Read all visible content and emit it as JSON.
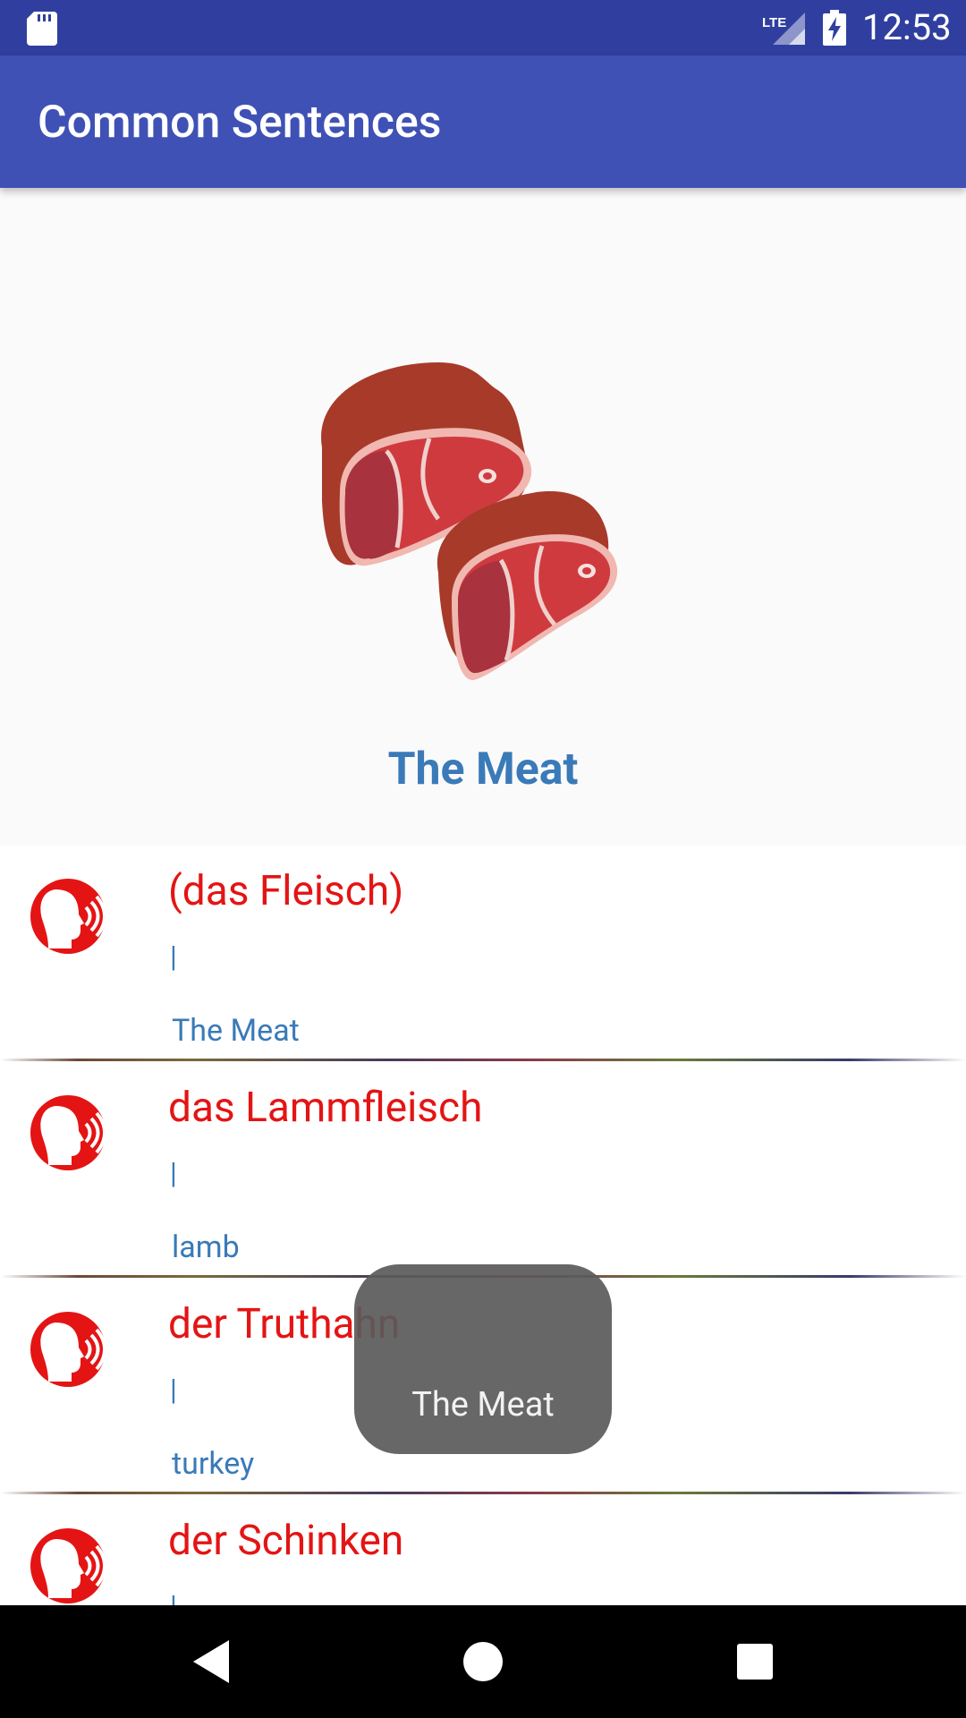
{
  "status_bar": {
    "network": "LTE",
    "time": "12:53"
  },
  "app_bar": {
    "title": "Common Sentences"
  },
  "hero": {
    "image_icon": "meat-steaks-illustration",
    "heading": "The Meat"
  },
  "list": {
    "items": [
      {
        "german": "(das Fleisch)",
        "separator": "|",
        "english": "The Meat",
        "icon": "speaker-head-icon"
      },
      {
        "german": "das Lammfleisch",
        "separator": "|",
        "english": "lamb",
        "icon": "speaker-head-icon"
      },
      {
        "german": "der Truthahn",
        "separator": "|",
        "english": "turkey",
        "icon": "speaker-head-icon"
      },
      {
        "german": "der Schinken",
        "separator": "|",
        "english": "",
        "icon": "speaker-head-icon"
      }
    ]
  },
  "toast": {
    "message": "The Meat"
  },
  "colors": {
    "status_bar": "#303f9f",
    "app_bar": "#3f51b5",
    "german_text": "#e41414",
    "english_text": "#3a7ab8",
    "speak_icon": "#e41414"
  },
  "navigation_bar": {
    "buttons": [
      "back-icon",
      "home-icon",
      "recents-icon"
    ]
  }
}
